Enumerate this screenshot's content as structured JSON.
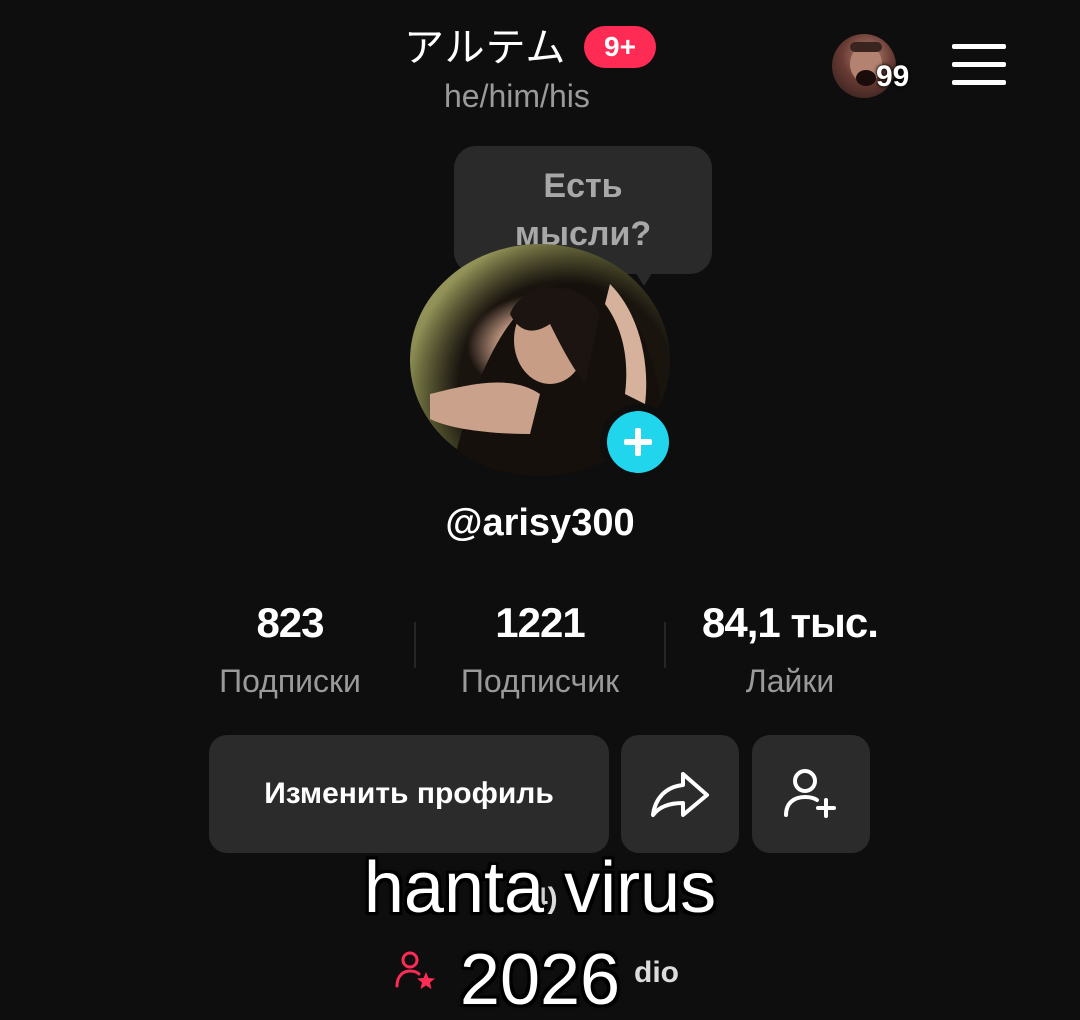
{
  "header": {
    "title": "アルテム",
    "badge": "9+",
    "pronouns": "he/him/his",
    "story_count": "99",
    "icons": {
      "menu": "hamburger-menu-icon",
      "avatar": "story-avatar"
    }
  },
  "note_bubble": {
    "line1": "Есть",
    "line2": "мысли?"
  },
  "profile": {
    "username": "@arisy300",
    "add_icon": "plus-icon"
  },
  "stats": [
    {
      "value": "823",
      "label": "Подписки"
    },
    {
      "value": "1221",
      "label": "Подписчик"
    },
    {
      "value": "84,1 тыс.",
      "label": "Лайки"
    }
  ],
  "actions": {
    "edit_profile": "Изменить профиль",
    "share_icon": "share-arrow-icon",
    "add_friend_icon": "add-user-icon"
  },
  "background_fragments": {
    "partial_1": "4)",
    "partial_2": "dio"
  },
  "caption": {
    "line1": "hanta virus",
    "line2": "2026"
  },
  "colors": {
    "background": "#0e0e0e",
    "badge": "#fe2c55",
    "accent_cyan": "#20d5ec",
    "button": "#2b2b2b",
    "muted_text": "#9a9a9a"
  }
}
